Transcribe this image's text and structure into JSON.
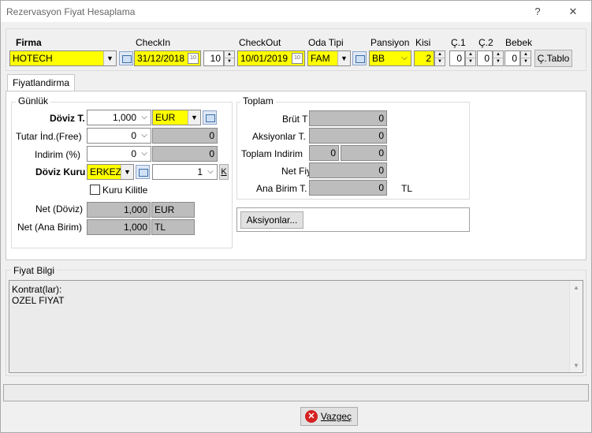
{
  "window": {
    "title": "Rezervasyon Fiyat Hesaplama",
    "help_label": "?",
    "close_label": "✕"
  },
  "header": {
    "firma": {
      "label": "Firma",
      "value": "HOTECH"
    },
    "checkin": {
      "label": "CheckIn",
      "value": "31/12/2018"
    },
    "nights": {
      "value": "10"
    },
    "checkout": {
      "label": "CheckOut",
      "value": "10/01/2019"
    },
    "oda_tipi": {
      "label": "Oda Tipi",
      "value": "FAM"
    },
    "pansiyon": {
      "label": "Pansiyon",
      "value": "BB"
    },
    "kisi": {
      "label": "Kisi",
      "value": "2"
    },
    "c1": {
      "label": "Ç.1",
      "value": "0"
    },
    "c2": {
      "label": "Ç.2",
      "value": "0"
    },
    "bebek": {
      "label": "Bebek",
      "value": "0"
    },
    "ctablo_label": "Ç.Tablo"
  },
  "tabs": [
    {
      "label": "Fiyatlandirma"
    }
  ],
  "gunluk": {
    "title": "Günlük",
    "doviz_t": {
      "label": "Döviz T.",
      "value": "1,000",
      "currency": "EUR"
    },
    "tutar_ind": {
      "label": "Tutar İnd.(Free)",
      "value": "0",
      "result": "0"
    },
    "indirim": {
      "label": "Indirim (%)",
      "value": "0",
      "result": "0"
    },
    "doviz_kuru": {
      "label": "Döviz Kuru",
      "type": "ERKEZ",
      "value": "1",
      "k_label": "K"
    },
    "kuru_kilitle": {
      "label": "Kuru Kilitle",
      "checked": false
    },
    "net_doviz": {
      "label": "Net (Döviz)",
      "value": "1,000",
      "currency": "EUR"
    },
    "net_ana": {
      "label": "Net (Ana Birim)",
      "value": "1,000",
      "currency": "TL"
    }
  },
  "toplam": {
    "title": "Toplam",
    "brut": {
      "label": "Brüt T",
      "value": "0"
    },
    "aksiyonlar": {
      "label": "Aksiyonlar T.",
      "value": "0"
    },
    "toplam_indirim": {
      "label": "Toplam Indirim",
      "value1": "0",
      "value2": "0"
    },
    "net_fiyat": {
      "label": "Net Fiy",
      "value": "0"
    },
    "ana_birim": {
      "label": "Ana Birim T.",
      "value": "0",
      "currency": "TL"
    }
  },
  "aksiyonlar_button": "Aksiyonlar...",
  "fiyat_bilgi": {
    "title": "Fiyat Bilgi",
    "lines": [
      "Kontrat(lar):",
      "OZEL FIYAT"
    ]
  },
  "footer": {
    "cancel_label": "Vazgeç"
  }
}
